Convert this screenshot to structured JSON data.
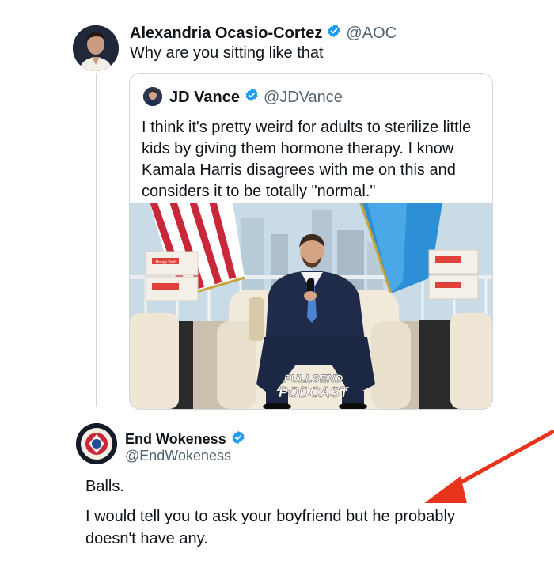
{
  "original_tweet": {
    "author_name": "Alexandria Ocasio-Cortez",
    "author_handle": "@AOC",
    "text": "Why are you sitting like that"
  },
  "quoted_tweet": {
    "author_name": "JD Vance",
    "author_handle": "@JDVance",
    "text": "I think it's pretty weird for adults to sterilize little kids by giving them hormone therapy. I know Kamala Harris disagrees with me on this and considers it to be totally \"normal.\"",
    "media": {
      "watermark_line1": "FULLSEND",
      "watermark_line2": "PODCAST",
      "box_label": "Happy Dad"
    }
  },
  "reply_tweet": {
    "author_name": "End Wokeness",
    "author_handle": "@EndWokeness",
    "line1": "Balls.",
    "line2": "I would tell you to ask your boyfriend but he probably doesn't have any."
  },
  "annotation": {
    "arrow_color": "#e8341c"
  },
  "colors": {
    "verified_blue": "#1d9bf0",
    "handle_gray": "#536471",
    "border": "#cfd9de"
  }
}
